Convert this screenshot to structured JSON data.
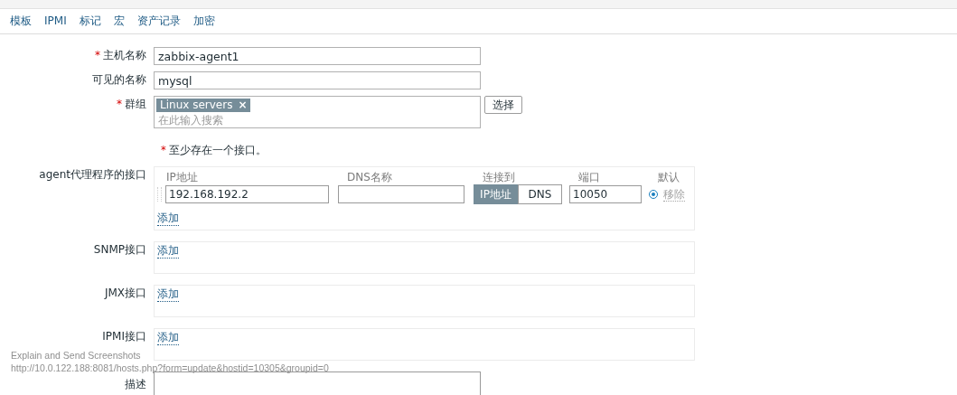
{
  "tabs": [
    {
      "label": "模板",
      "selected": false
    },
    {
      "label": "IPMI",
      "selected": false
    },
    {
      "label": "标记",
      "selected": false
    },
    {
      "label": "宏",
      "selected": false
    },
    {
      "label": "资产记录",
      "selected": false
    },
    {
      "label": "加密",
      "selected": false
    }
  ],
  "form": {
    "host_name": {
      "label": "主机名称",
      "required_mark": "*",
      "value": "zabbix-agent1"
    },
    "visible_name": {
      "label": "可见的名称",
      "value": "mysql"
    },
    "groups": {
      "label": "群组",
      "required_mark": "*",
      "tags": [
        {
          "label": "Linux servers",
          "remove": "×"
        }
      ],
      "placeholder": "在此输入搜索",
      "select_button": "选择"
    },
    "note": {
      "required_mark": "*",
      "text": "至少存在一个接口。"
    },
    "agent_interfaces": {
      "label": "agent代理程序的接口",
      "columns": [
        "IP地址",
        "DNS名称",
        "连接到",
        "端口",
        "默认"
      ],
      "rows": [
        {
          "ip": "192.168.192.2",
          "dns": "",
          "connect": [
            {
              "label": "IP地址",
              "selected": true
            },
            {
              "label": "DNS",
              "selected": false
            }
          ],
          "port": "10050",
          "default": true,
          "remove": "移除"
        }
      ],
      "add": "添加"
    },
    "other_interfaces": [
      {
        "label": "SNMP接口",
        "add": "添加"
      },
      {
        "label": "JMX接口",
        "add": "添加"
      },
      {
        "label": "IPMI接口",
        "add": "添加"
      }
    ],
    "description": {
      "label": "描述"
    }
  },
  "status_overlay": {
    "title": "Explain and Send Screenshots",
    "url": "http://10.0.122.188:8081/hosts.php?form=update&hostid=10305&groupid=0"
  }
}
